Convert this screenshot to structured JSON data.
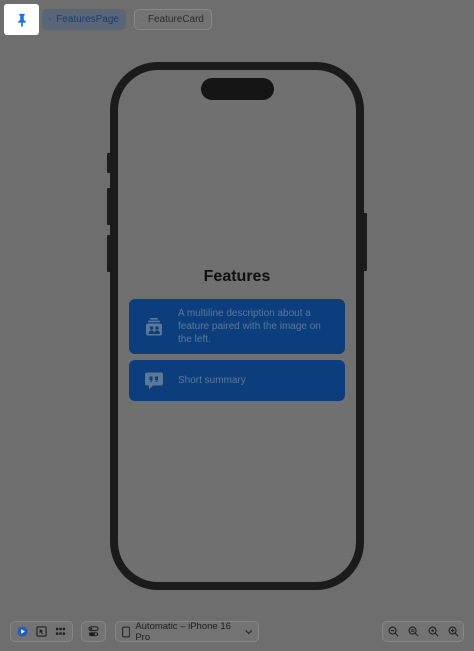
{
  "toolbar": {
    "pin_icon": "pin-icon",
    "tabs": [
      {
        "label": "FeaturesPage",
        "icon": "pin-icon",
        "active": true
      },
      {
        "label": "FeatureCard",
        "icon": "card-icon",
        "active": false
      }
    ]
  },
  "preview": {
    "title": "Features",
    "cards": [
      {
        "icon": "photo-person-icon",
        "text": "A multiline description about a feature paired with the image on the left."
      },
      {
        "icon": "quote-bubble-icon",
        "text": "Short summary"
      }
    ]
  },
  "bottom_bar": {
    "modes": [
      "live-icon",
      "selectable-icon",
      "variants-icon"
    ],
    "toggle_icon": "device-settings-icon",
    "device_label": "Automatic – iPhone 16 Pro",
    "zoom_icons": [
      "zoom-out-icon",
      "zoom-fit-icon",
      "zoom-100-icon",
      "zoom-in-icon"
    ]
  },
  "colors": {
    "pin_accent": "#1f6fe8",
    "card_background": "#0c3e7e",
    "overlay": "#6e6e6e"
  }
}
